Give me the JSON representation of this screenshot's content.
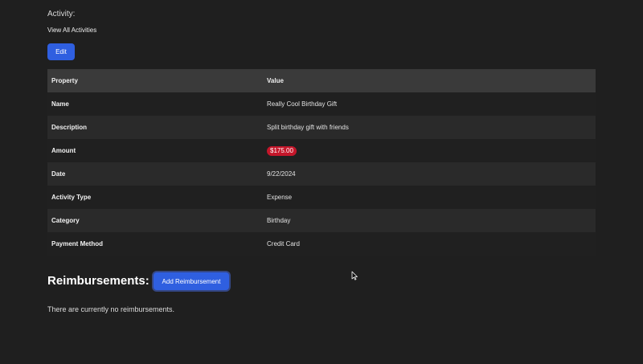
{
  "activity": {
    "heading": "Activity:",
    "view_all_link": "View All Activities",
    "edit_label": "Edit"
  },
  "table": {
    "headers": {
      "property": "Property",
      "value": "Value"
    },
    "rows": [
      {
        "property": "Name",
        "value": "Really Cool Birthday Gift"
      },
      {
        "property": "Description",
        "value": "Split birthday gift with friends"
      },
      {
        "property": "Amount",
        "value": "$175.00"
      },
      {
        "property": "Date",
        "value": "9/22/2024"
      },
      {
        "property": "Activity Type",
        "value": "Expense"
      },
      {
        "property": "Category",
        "value": "Birthday"
      },
      {
        "property": "Payment Method",
        "value": "Credit Card"
      }
    ]
  },
  "reimbursements": {
    "title": "Reimbursements:",
    "add_label": "Add Reimbursement",
    "empty_message": "There are currently no reimbursements."
  },
  "colors": {
    "background": "#1f1f1f",
    "primary_button": "#2f5fe0",
    "amount_badge": "#c4162a",
    "table_header": "#3a3a3a"
  },
  "icons": {
    "cursor": "mouse-pointer-icon"
  }
}
